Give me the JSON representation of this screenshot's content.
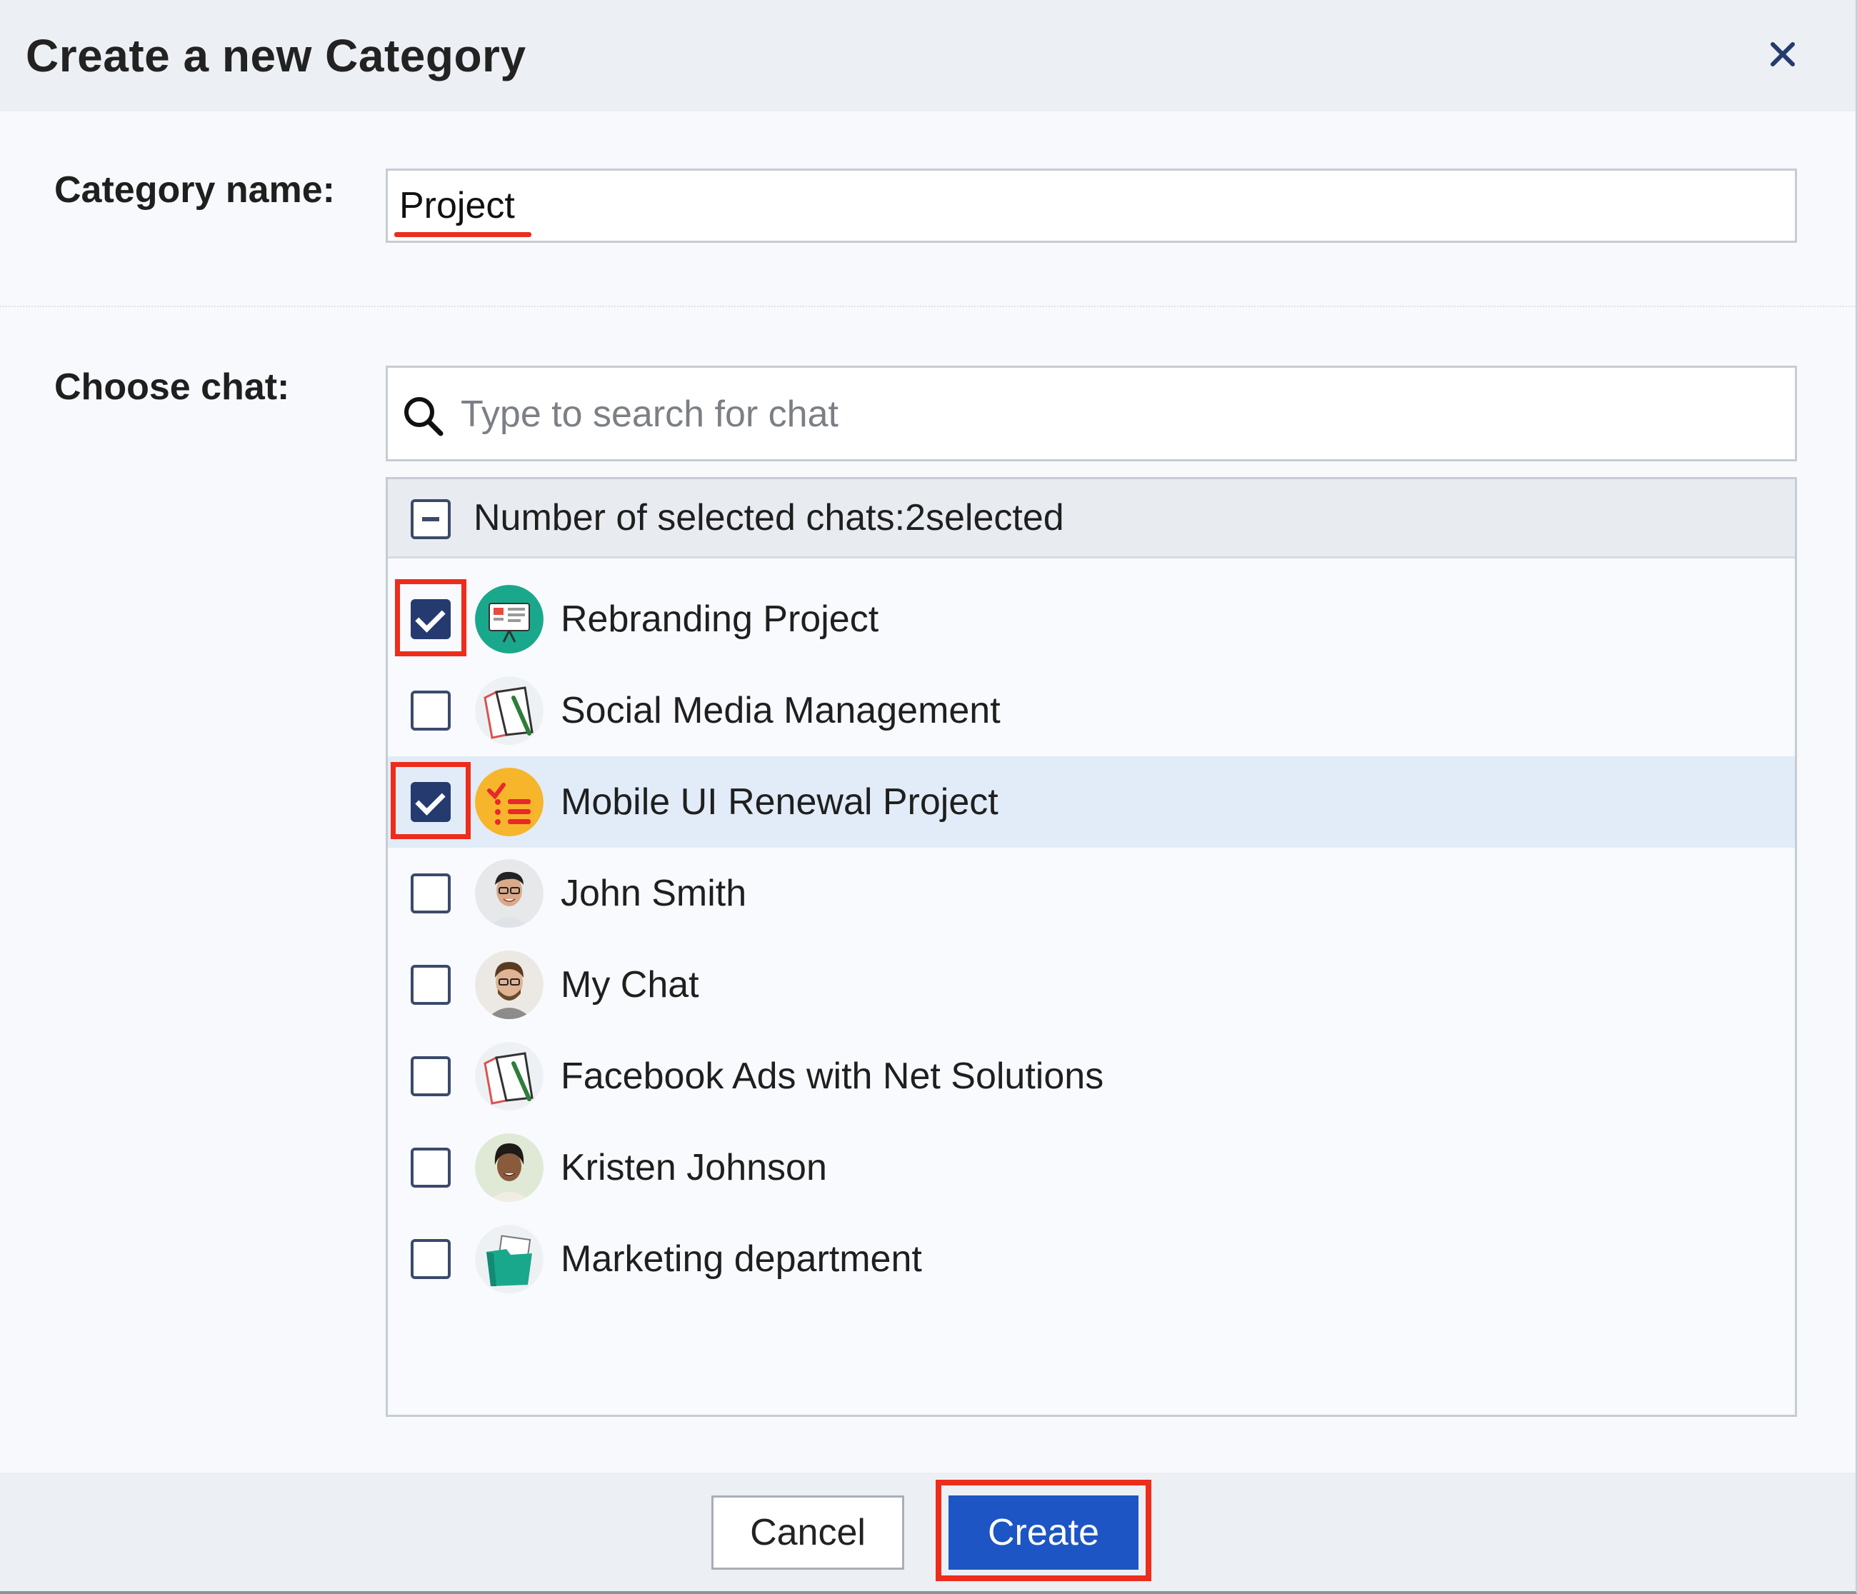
{
  "dialog": {
    "title": "Create a new Category",
    "close_label": "×"
  },
  "category_name": {
    "label": "Category name:",
    "value": "Project"
  },
  "choose_chat": {
    "label": "Choose chat:",
    "search_placeholder": "Type to search for chat",
    "selection_summary": "Number of selected chats:2selected",
    "items": [
      {
        "label": "Rebranding Project",
        "checked": true,
        "icon": "presentation-board-icon"
      },
      {
        "label": "Social Media Management",
        "checked": false,
        "icon": "notebook-pen-icon"
      },
      {
        "label": "Mobile UI Renewal Project",
        "checked": true,
        "icon": "checklist-icon"
      },
      {
        "label": "John Smith",
        "checked": false,
        "icon": "avatar-photo"
      },
      {
        "label": "My Chat",
        "checked": false,
        "icon": "avatar-photo"
      },
      {
        "label": "Facebook Ads with Net Solutions",
        "checked": false,
        "icon": "notebook-pen-icon"
      },
      {
        "label": "Kristen Johnson",
        "checked": false,
        "icon": "avatar-photo"
      },
      {
        "label": "Marketing department",
        "checked": false,
        "icon": "folder-icon"
      }
    ]
  },
  "footer": {
    "cancel_label": "Cancel",
    "create_label": "Create"
  },
  "colors": {
    "primary_button": "#1d55c4",
    "checkbox_checked": "#253a6e",
    "highlight_annotation": "#ee2c1c",
    "row_hover": "#e1ecf8"
  }
}
